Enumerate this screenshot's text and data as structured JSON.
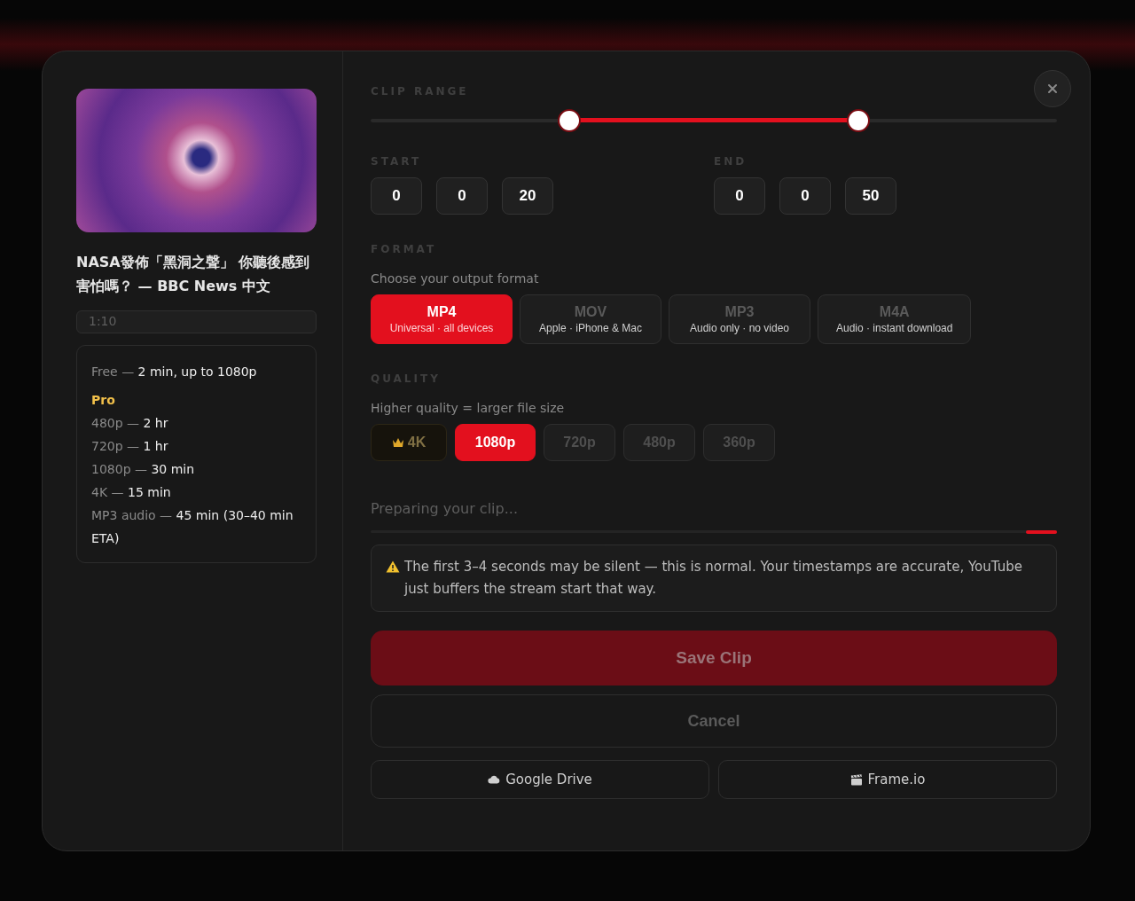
{
  "video": {
    "title": "NASA發佈「黑洞之聲」 你聽後感到害怕嗎？ — BBC News 中文",
    "duration": "1:10"
  },
  "limits": {
    "free": {
      "label": "Free —",
      "value": "2 min, up to 1080p"
    },
    "pro_heading": "Pro",
    "pro": [
      {
        "label": "480p —",
        "value": "2 hr"
      },
      {
        "label": "720p —",
        "value": "1 hr"
      },
      {
        "label": "1080p —",
        "value": "30 min"
      },
      {
        "label": "4K —",
        "value": "15 min"
      },
      {
        "label": "MP3 audio —",
        "value": "45 min (30–40 min ETA)"
      }
    ]
  },
  "clip_range": {
    "heading": "CLIP RANGE",
    "thumbs": [
      {
        "level": 0.29
      },
      {
        "level": 0.71
      }
    ]
  },
  "start": {
    "label": "START",
    "fields": [
      "0",
      "0",
      "20"
    ]
  },
  "end": {
    "label": "END",
    "fields": [
      "0",
      "0",
      "50"
    ]
  },
  "format": {
    "heading": "FORMAT",
    "hint": "Choose your output format",
    "options": [
      {
        "name": "MP4",
        "detail": "Universal · all devices",
        "selected": true
      },
      {
        "name": "MOV",
        "detail": "Apple · iPhone & Mac",
        "selected": false
      },
      {
        "name": "MP3",
        "detail": "Audio only · no video",
        "selected": false
      },
      {
        "name": "M4A",
        "detail": "Audio · instant download",
        "selected": false
      }
    ]
  },
  "quality": {
    "heading": "QUALITY",
    "hint": "Higher quality = larger file size",
    "options": [
      {
        "label": "4K",
        "kind": "pro",
        "selected": false
      },
      {
        "label": "1080p",
        "kind": "standard",
        "selected": true
      },
      {
        "label": "720p",
        "kind": "standard",
        "selected": false
      },
      {
        "label": "480p",
        "kind": "standard",
        "selected": false
      },
      {
        "label": "360p",
        "kind": "standard",
        "selected": false
      }
    ]
  },
  "status": "Preparing your clip...",
  "progress": {
    "level": 0.045
  },
  "notice": "The first 3–4 seconds may be silent — this is normal. Your timestamps are accurate, YouTube just buffers the stream start that way.",
  "buttons": {
    "save": "Save Clip",
    "cancel": "Cancel",
    "exports": [
      {
        "label": "Google Drive",
        "kind": "drive"
      },
      {
        "label": "Frame.io",
        "kind": "frameio"
      }
    ]
  }
}
